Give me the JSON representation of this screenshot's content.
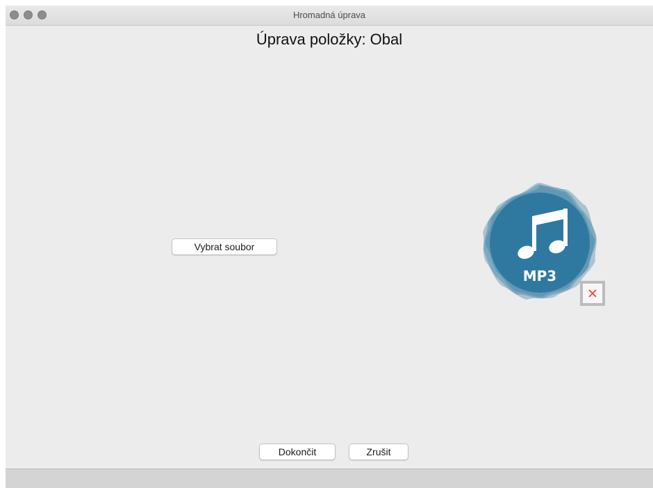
{
  "window": {
    "title": "Hromadná úprava"
  },
  "dialog": {
    "heading": "Úprava položky: Obal",
    "choose_file_label": "Vybrat soubor",
    "cover_label": "MP3",
    "cover_color": "#2f79a1",
    "remove_icon_color": "#e04a44"
  },
  "actions": {
    "finish_label": "Dokončit",
    "cancel_label": "Zrušit"
  }
}
